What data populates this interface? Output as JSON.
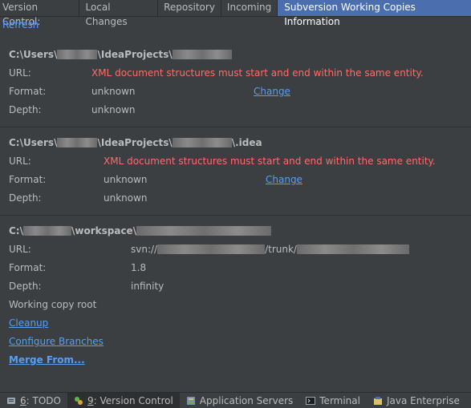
{
  "tabbar": {
    "title": "Version Control:",
    "tabs": [
      "Local Changes",
      "Repository",
      "Incoming",
      "Subversion Working Copies Information"
    ]
  },
  "refresh": "Refresh",
  "labels": {
    "url": "URL:",
    "format": "Format:",
    "depth": "Depth:"
  },
  "copies": [
    {
      "path_prefix": "C:\\Users\\",
      "path_mid": "\\IdeaProjects\\",
      "path_suffix": "",
      "url_error": "XML document structures must start and end within the same entity.",
      "format": "unknown",
      "depth": "unknown",
      "change": "Change"
    },
    {
      "path_prefix": "C:\\Users\\",
      "path_mid": "\\IdeaProjects\\",
      "path_suffix": "\\.idea",
      "url_error": "XML document structures must start and end within the same entity.",
      "format": "unknown",
      "depth": "unknown",
      "change": "Change"
    },
    {
      "path_prefix": "C:\\",
      "path_mid": "\\workspace\\",
      "path_suffix": "",
      "url_prefix": "svn://",
      "url_mid": "/trunk/",
      "format": "1.8",
      "depth": "infinity",
      "working_copy_root": "Working copy root",
      "cleanup": "Cleanup",
      "configure_branches": "Configure Branches",
      "merge_from": "Merge From..."
    }
  ],
  "bottombar": [
    {
      "key": "6",
      "label": ": TODO",
      "icon": "todo-icon"
    },
    {
      "key": "9",
      "label": ": Version Control",
      "icon": "version-control-icon",
      "active": true
    },
    {
      "key": "",
      "label": "Application Servers",
      "icon": "server-icon"
    },
    {
      "key": "",
      "label": "Terminal",
      "icon": "terminal-icon"
    },
    {
      "key": "",
      "label": "Java Enterprise",
      "icon": "java-enterprise-icon"
    }
  ],
  "colors": {
    "background": "#3c3f41",
    "active_tab": "#4b6eaf",
    "link": "#589df6",
    "error": "#ff6b68",
    "text": "#bbbbbb"
  }
}
